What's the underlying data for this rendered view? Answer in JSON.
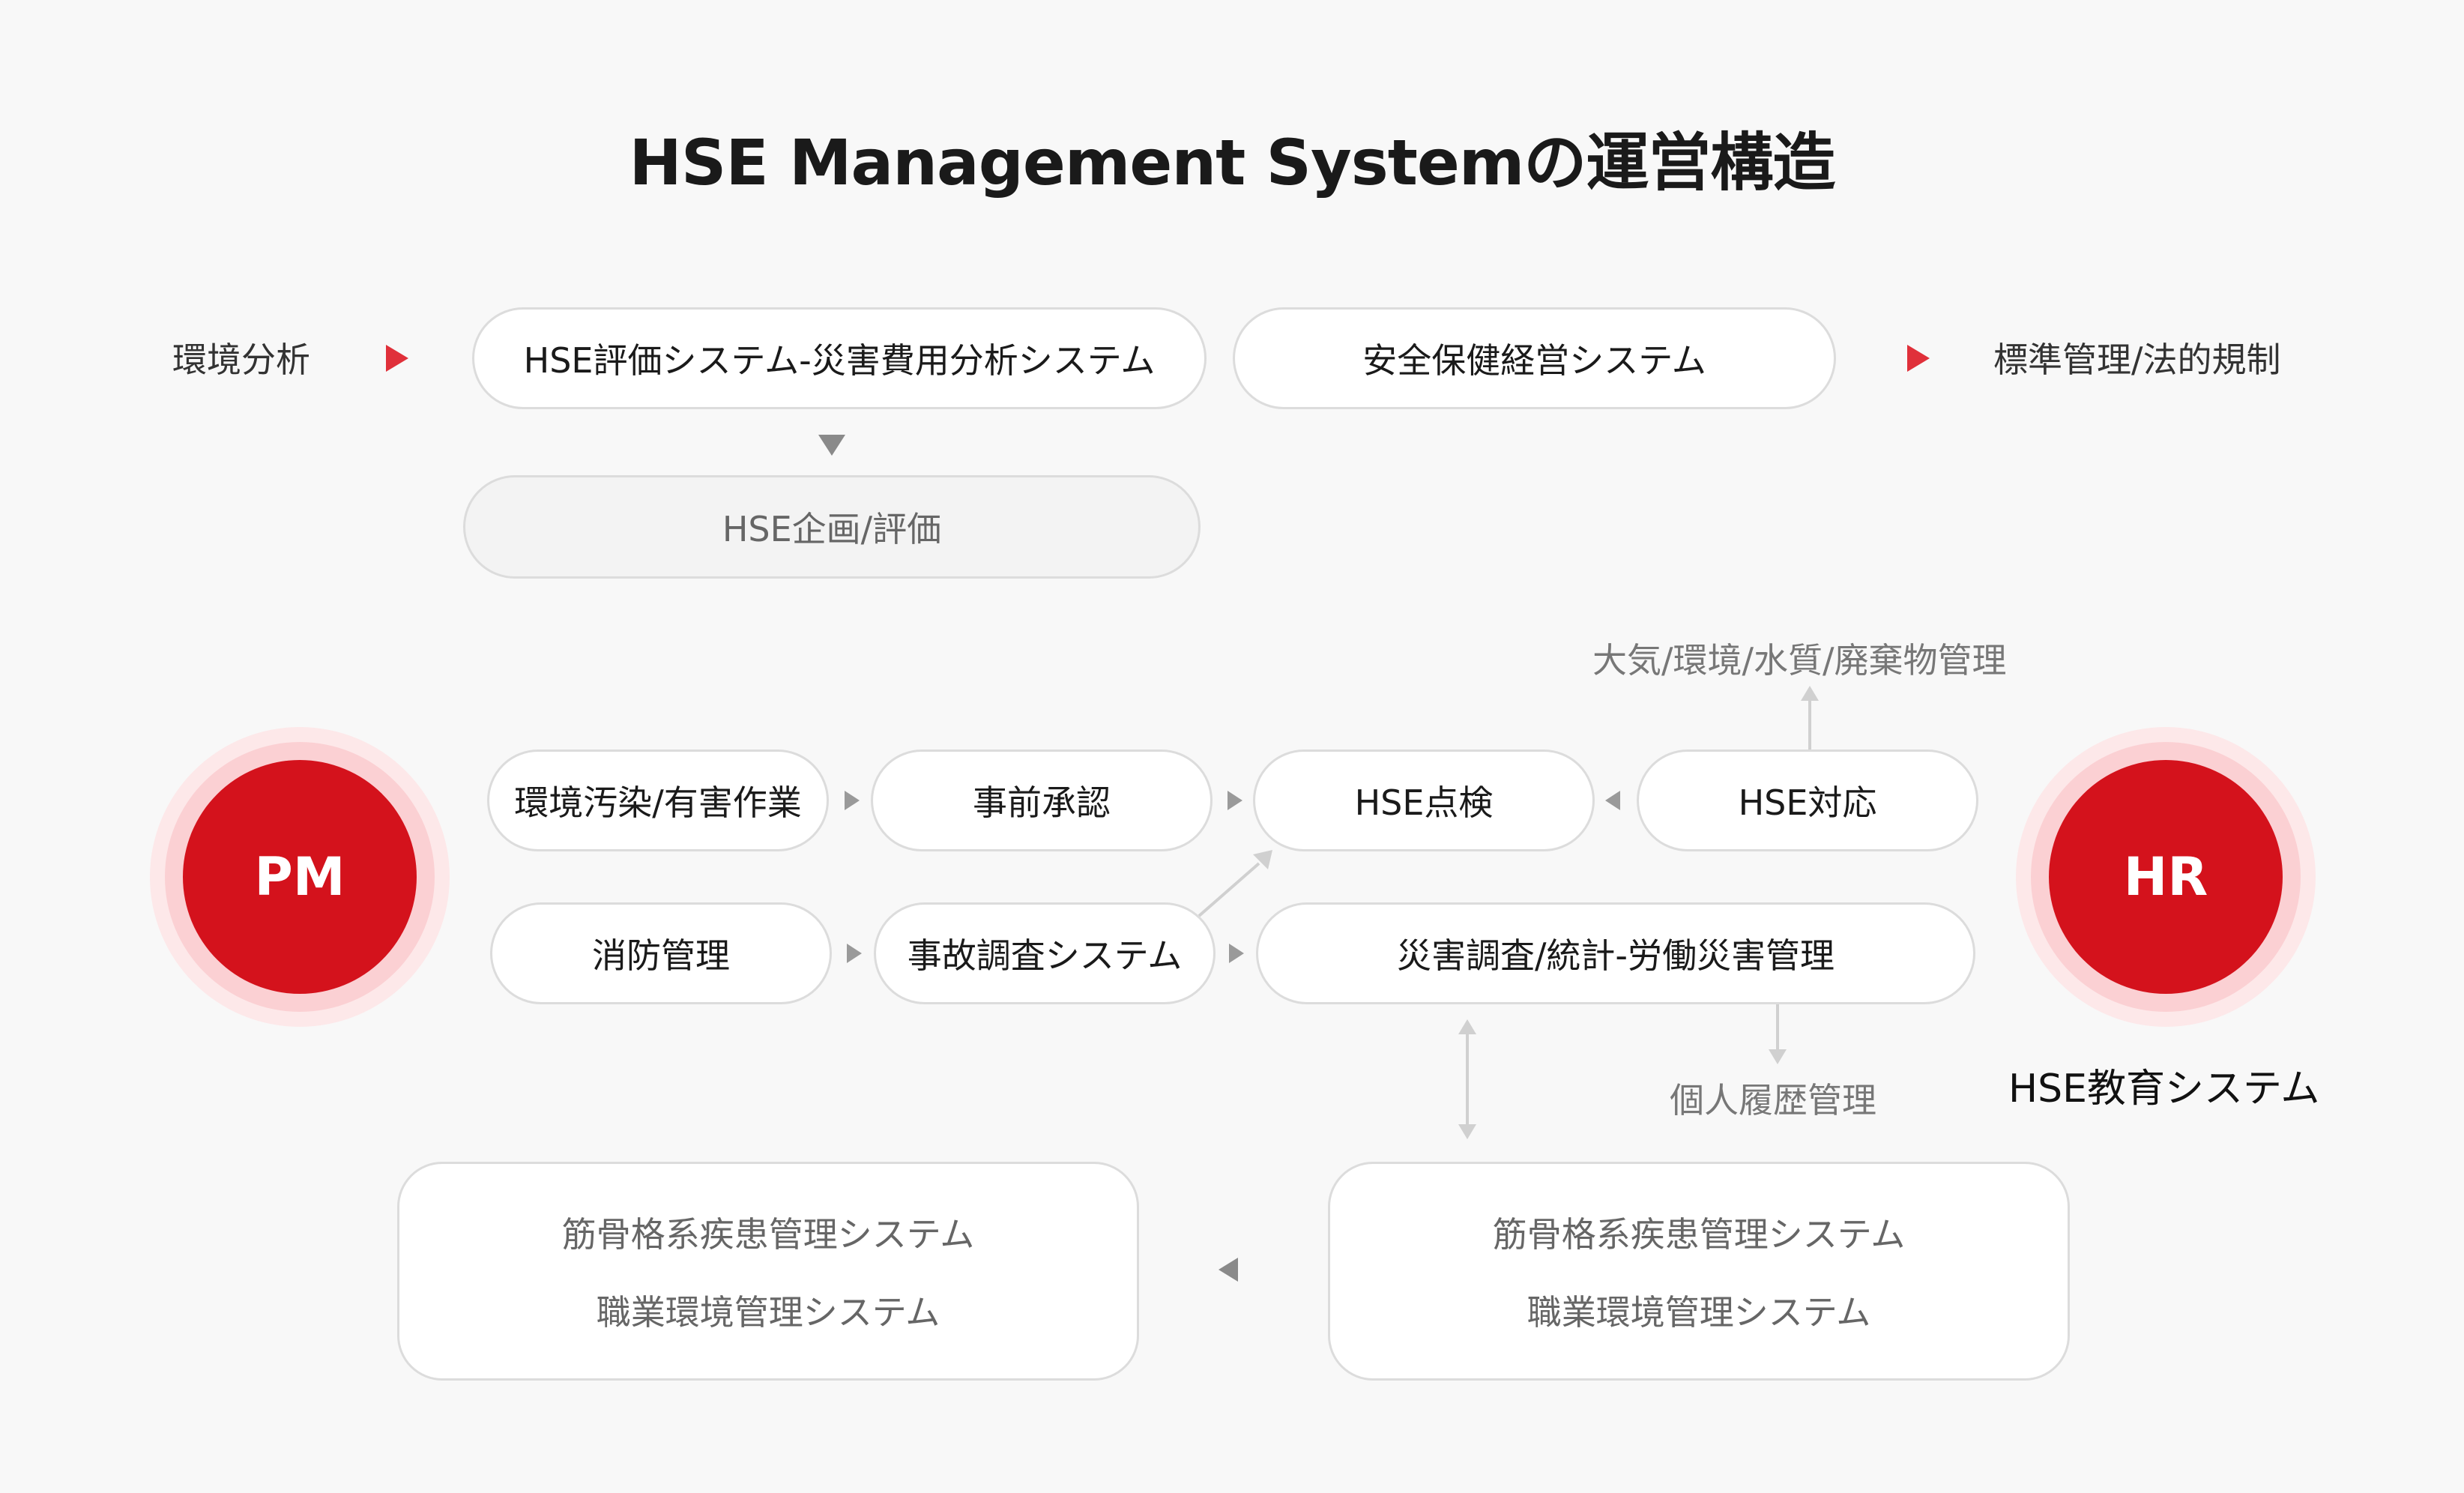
{
  "title": "HSE Management Systemの運営構造",
  "top_row": {
    "left_label": "環境分析",
    "pill_1": "HSE評価システム-災害費用分析システム",
    "pill_2": "安全保健経営システム",
    "right_label": "標準管理/法的規制",
    "sub_pill": "HSE企画/評価"
  },
  "middle": {
    "top_annotation": "大気/環境/水質/廃棄物管理",
    "row1": [
      "環境汚染/有害作業",
      "事前承認",
      "HSE点検",
      "HSE対応"
    ],
    "row2": [
      "消防管理",
      "事故調査システム",
      "災害調査/統計-労働災害管理"
    ],
    "bottom_annotation": "個人履歴管理",
    "pm_label": "PM",
    "hr_label": "HR",
    "hr_caption": "HSE教育システム"
  },
  "bottom": {
    "left_box": [
      "筋骨格系疾患管理システム",
      "職業環境管理システム"
    ],
    "right_box": [
      "筋骨格系疾患管理システム",
      "職業環境管理システム"
    ]
  },
  "colors": {
    "accent_red": "#d4121c",
    "arrow_red": "#e0303a",
    "border_grey": "#dcdcdc",
    "background": "#f8f8f8"
  }
}
